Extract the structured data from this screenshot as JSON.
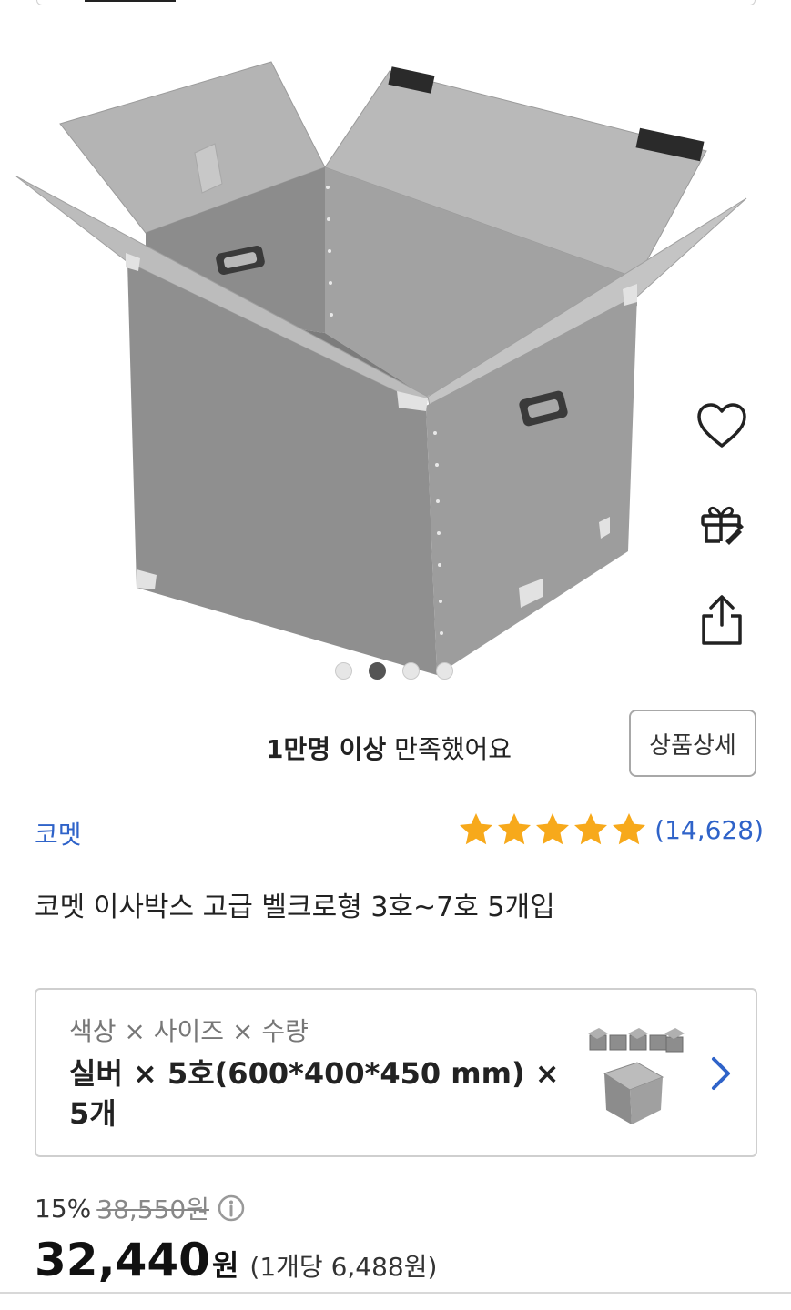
{
  "hero": {
    "image_alt": "silver plastic moving box with open flaps",
    "carousel": {
      "total": 4,
      "active_index": 1
    },
    "actions": [
      {
        "name": "heart-icon",
        "label": "찜하기"
      },
      {
        "name": "gift-icon",
        "label": "선물하기"
      },
      {
        "name": "share-icon",
        "label": "공유하기"
      }
    ]
  },
  "satisfaction": {
    "bold": "1만명 이상",
    "rest": " 만족했어요",
    "detail_button": "상품상세"
  },
  "product": {
    "brand": "코멧",
    "rating_stars": 5,
    "review_count": "(14,628)",
    "title": "코멧 이사박스 고급 벨크로형 3호~7호 5개입"
  },
  "option": {
    "label": "색상 × 사이즈 × 수량",
    "value": "실버 × 5호(600*400*450 mm) × 5개",
    "thumb_icon": "box-thumbnail",
    "chevron_icon": "chevron-right-icon"
  },
  "price": {
    "discount": "15%",
    "original": "38,550원",
    "final": "32,440",
    "won": "원",
    "unit": "(1개당 6,488원)"
  },
  "colors": {
    "accent_blue": "#2f63c9",
    "star": "#f7a91b",
    "box_gray": "#8e8e8e"
  }
}
